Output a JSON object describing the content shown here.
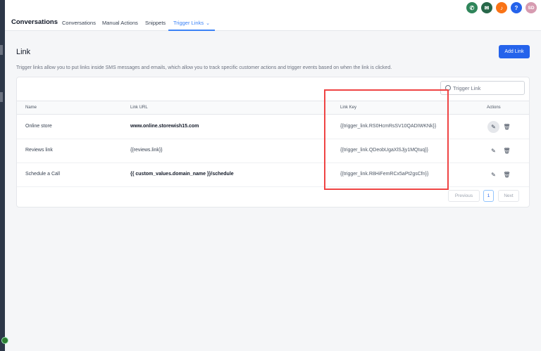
{
  "header": {
    "app_title": "Conversations",
    "tabs": [
      {
        "label": "Conversations"
      },
      {
        "label": "Manual Actions"
      },
      {
        "label": "Snippets"
      },
      {
        "label": "Trigger Links"
      }
    ],
    "avatar_initials": "SD",
    "icons": [
      "phone-icon",
      "megaphone-icon",
      "bell-icon",
      "help-icon"
    ]
  },
  "page": {
    "title": "Link",
    "description": "Trigger links allow you to put links inside SMS messages and emails, which allow you to track specific customer actions and trigger events based on when the link is clicked.",
    "add_button": "Add Link"
  },
  "search": {
    "placeholder": "Trigger Link"
  },
  "table": {
    "headers": [
      "Name",
      "Link URL",
      "Link Key",
      "Actions"
    ],
    "rows": [
      {
        "name": "Online store",
        "url": "www.online.storewish15.com",
        "key": "{{trigger_link.RS0HcmRsSV10QADIWKNk}}"
      },
      {
        "name": "Reviews link",
        "url": "{{reviews.link}}",
        "key": "{{trigger_link.QDeobUgaXlSJjy1MQtuq}}"
      },
      {
        "name": "Schedule a Call",
        "url": "{{ custom_values.domain_name }}/schedule",
        "key": "{{trigger_link.R8HiFemRCx5aPt2gsCfn}}"
      }
    ]
  },
  "pagination": {
    "previous": "Previous",
    "current": "1",
    "next": "Next"
  },
  "colors": {
    "accent": "#2563eb",
    "highlight": "#ef4444"
  }
}
